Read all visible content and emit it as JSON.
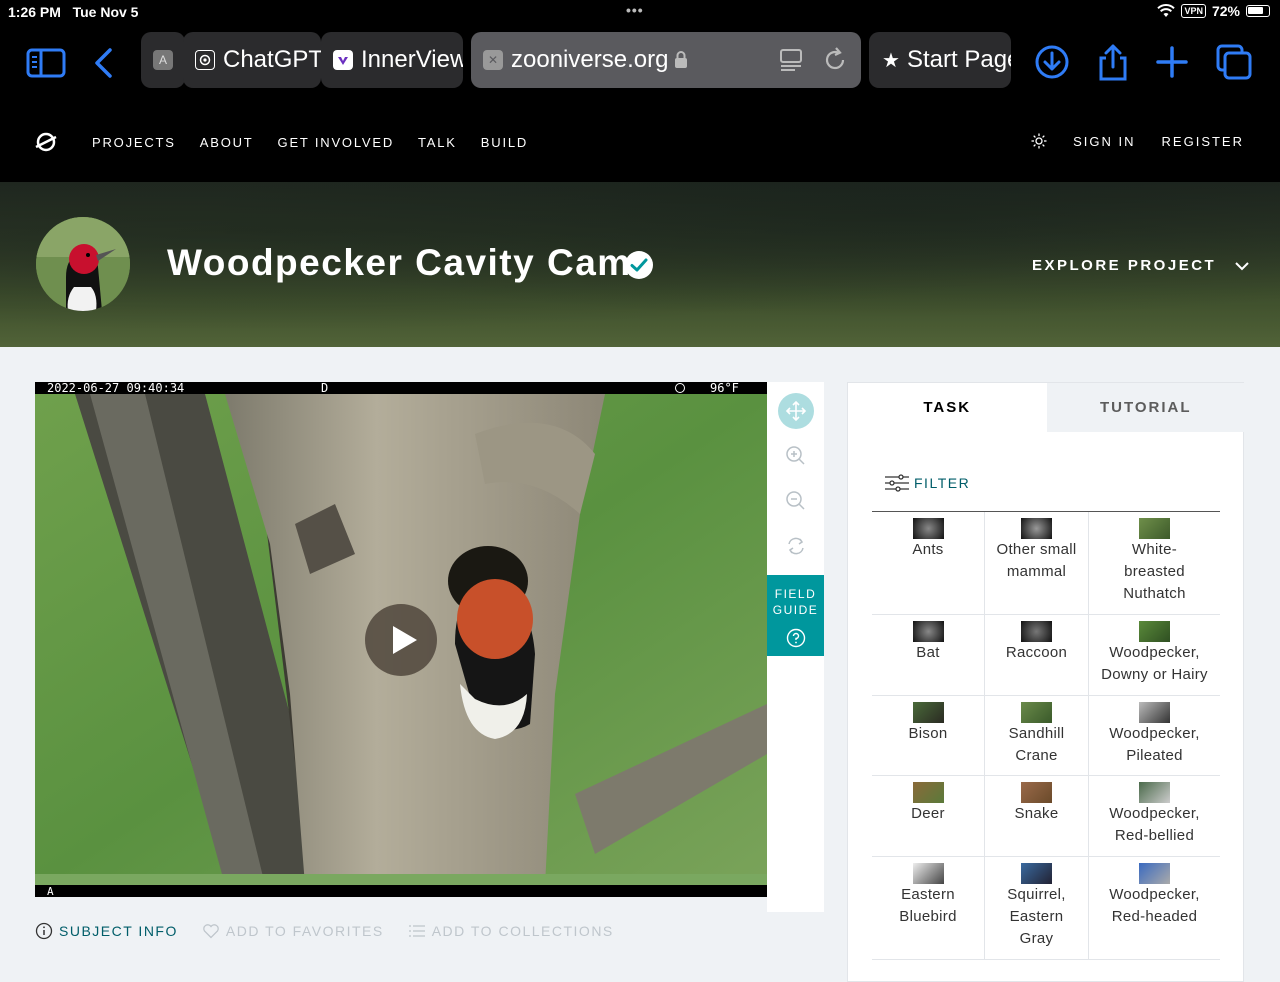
{
  "status": {
    "time": "1:26 PM",
    "date": "Tue Nov 5",
    "vpn": "VPN",
    "battery": "72%"
  },
  "browser": {
    "tabs": [
      {
        "label": "A",
        "favicon": "A"
      },
      {
        "label": "ChatGPT"
      },
      {
        "label": "InnerView"
      },
      {
        "label": "zooniverse.org",
        "active": true
      },
      {
        "label": "Start Page"
      }
    ]
  },
  "nav": {
    "links": [
      "PROJECTS",
      "ABOUT",
      "GET INVOLVED",
      "TALK",
      "BUILD"
    ],
    "sign_in": "SIGN IN",
    "register": "REGISTER"
  },
  "project": {
    "title": "Woodpecker Cavity Cam",
    "explore": "EXPLORE PROJECT"
  },
  "camera": {
    "timestamp": "2022-06-27  09:40:34",
    "mode": "D",
    "temp": "96°F",
    "marker": "A"
  },
  "field_guide": {
    "line1": "FIELD",
    "line2": "GUIDE"
  },
  "actions": {
    "subject_info": "SUBJECT INFO",
    "favorites": "ADD TO FAVORITES",
    "collections": "ADD TO COLLECTIONS"
  },
  "panel": {
    "task": "TASK",
    "tutorial": "TUTORIAL",
    "filter": "FILTER",
    "choices": [
      [
        "Ants",
        "Other small mammal",
        "White-breasted Nuthatch"
      ],
      [
        "Bat",
        "Raccoon",
        "Woodpecker, Downy or Hairy"
      ],
      [
        "Bison",
        "Sandhill Crane",
        "Woodpecker, Pileated"
      ],
      [
        "Deer",
        "Snake",
        "Woodpecker, Red-bellied"
      ],
      [
        "Eastern Bluebird",
        "Squirrel, Eastern Gray",
        "Woodpecker, Red-headed"
      ]
    ]
  },
  "colors": {
    "accent": "#00979d",
    "link": "#005d69",
    "safari_blue": "#2f7cf6"
  }
}
